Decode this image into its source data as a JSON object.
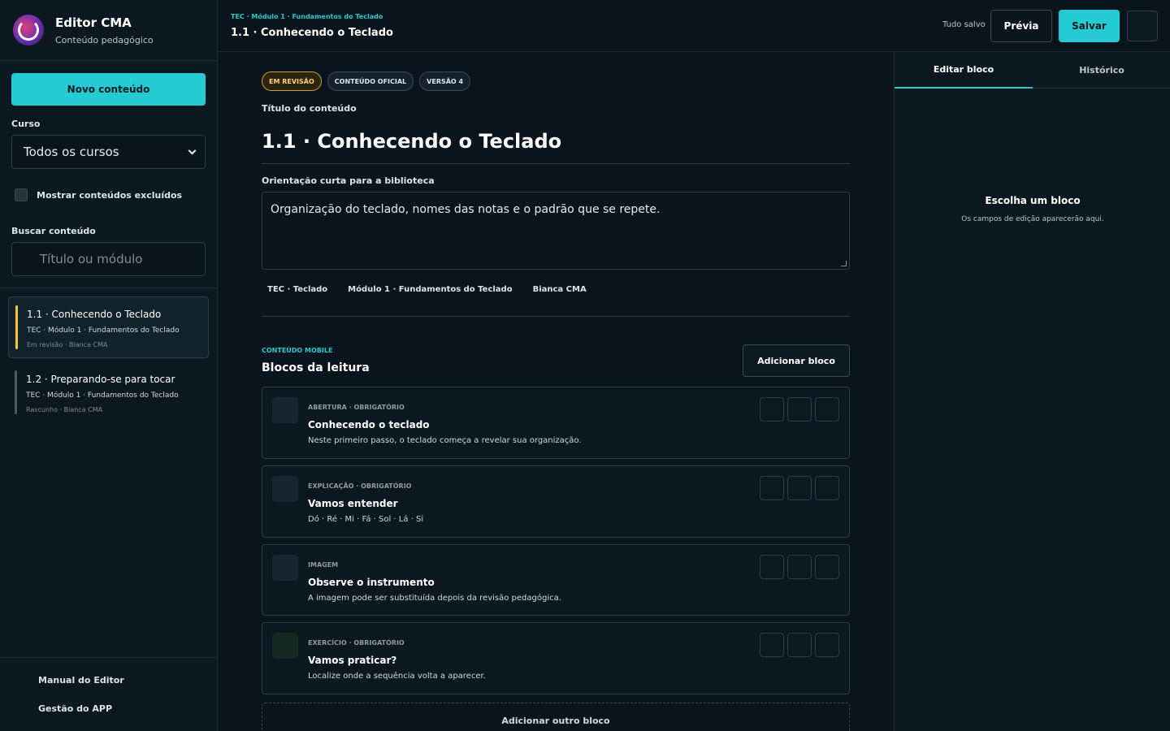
{
  "app": {
    "title": "Editor CMA",
    "subtitle": "Conteúdo pedagógico"
  },
  "sidebar": {
    "new_button": "Novo conteúdo",
    "course_label": "Curso",
    "course_value": "Todos os cursos",
    "show_deleted_label": "Mostrar conteúdos excluídos",
    "search_label": "Buscar conteúdo",
    "search_placeholder": "Título ou módulo",
    "items": [
      {
        "title": "1.1 · Conhecendo o Teclado",
        "path": "TEC · Módulo 1 · Fundamentos do Teclado",
        "meta": "Em revisão · Bianca CMA",
        "status_color": "#f5c542"
      },
      {
        "title": "1.2 · Preparando-se para tocar",
        "path": "TEC · Módulo 1 · Fundamentos do Teclado",
        "meta": "Rascunho · Bianca CMA",
        "status_color": "#4a5a65"
      }
    ],
    "footer": {
      "manual": "Manual do Editor",
      "app_management": "Gestão do APP"
    }
  },
  "topbar": {
    "breadcrumb": "TEC · Módulo 1 · Fundamentos do Teclado",
    "title": "1.1 · Conhecendo o Teclado",
    "saved_status": "Tudo salvo",
    "preview_label": "Prévia",
    "save_label": "Salvar"
  },
  "editor": {
    "badges": {
      "review": "EM REVISÃO",
      "official": "CONTEÚDO OFICIAL",
      "version": "VERSÃO 4"
    },
    "title_label": "Título do conteúdo",
    "title_value": "1.1 · Conhecendo o Teclado",
    "guidance_label": "Orientação curta para a biblioteca",
    "guidance_value": "Organização do teclado, nomes das notas e o padrão que se repete.",
    "tags": {
      "course": "TEC · Teclado",
      "module": "Módulo 1 · Fundamentos do Teclado",
      "author": "Bianca CMA"
    },
    "section_kicker": "CONTEÚDO MOBILE",
    "section_title": "Blocos da leitura",
    "add_block_label": "Adicionar bloco",
    "blocks": [
      {
        "kind": "ABERTURA · OBRIGATÓRIO",
        "title": "Conhecendo o teclado",
        "desc": "Neste primeiro passo, o teclado começa a revelar sua organização."
      },
      {
        "kind": "EXPLICAÇÃO · OBRIGATÓRIO",
        "title": "Vamos entender",
        "desc": "Dó · Ré · Mi · Fá · Sol · Lá · Si"
      },
      {
        "kind": "IMAGEM",
        "title": "Observe o instrumento",
        "desc": "A imagem pode ser substituída depois da revisão pedagógica."
      },
      {
        "kind": "EXERCÍCIO · OBRIGATÓRIO",
        "title": "Vamos praticar?",
        "desc": "Localize onde a sequência volta a aparecer."
      }
    ],
    "add_other_label": "Adicionar outro bloco"
  },
  "panel": {
    "tabs": {
      "edit": "Editar bloco",
      "history": "Histórico"
    },
    "empty_title": "Escolha um bloco",
    "empty_sub": "Os campos de edição aparecerão aqui."
  },
  "colors": {
    "accent": "#25cbd3",
    "review": "#f5c542"
  }
}
